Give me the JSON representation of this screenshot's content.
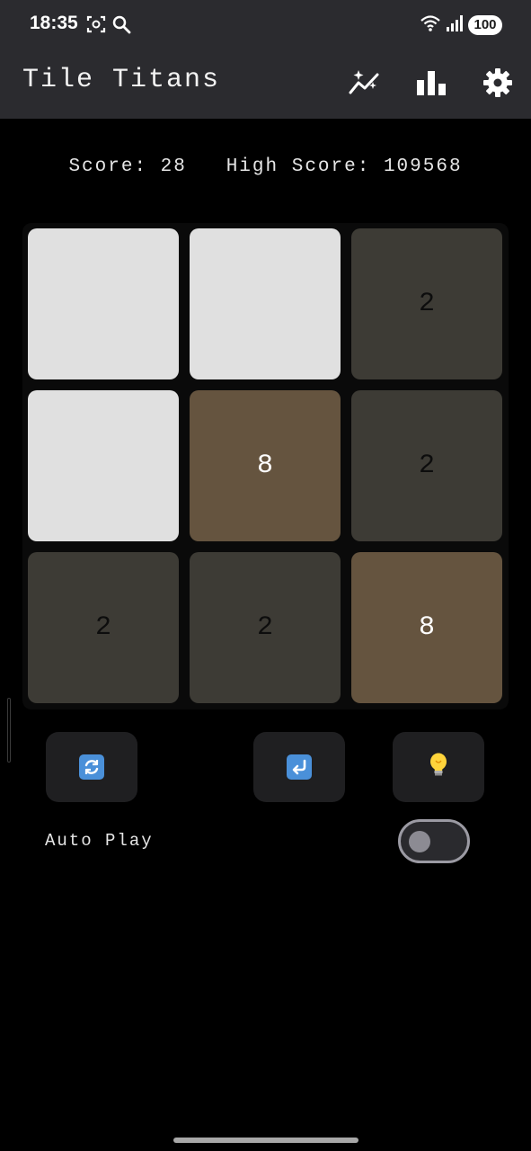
{
  "status_bar": {
    "time": "18:35",
    "battery": "100",
    "icons": [
      "screenshot-scan-icon",
      "search-icon",
      "wifi-icon",
      "signal-icon",
      "battery-icon"
    ]
  },
  "app_bar": {
    "title": "Tile Titans",
    "actions": [
      "magic-chart-icon",
      "bar-chart-icon",
      "gear-icon"
    ]
  },
  "scores": {
    "score_label": "Score:",
    "score_value": "28",
    "high_score_label": "High Score:",
    "high_score_value": "109568"
  },
  "board": {
    "size": 3,
    "tiles": [
      {
        "value": "",
        "color": "#e0e0e0",
        "text_color": "#111111"
      },
      {
        "value": "",
        "color": "#e0e0e0",
        "text_color": "#111111"
      },
      {
        "value": "2",
        "color": "#3d3b35",
        "text_color": "#0d0d0d"
      },
      {
        "value": "",
        "color": "#e0e0e0",
        "text_color": "#111111"
      },
      {
        "value": "8",
        "color": "#65543f",
        "text_color": "#ffffff"
      },
      {
        "value": "2",
        "color": "#3d3b35",
        "text_color": "#0d0d0d"
      },
      {
        "value": "2",
        "color": "#3d3b35",
        "text_color": "#0d0d0d"
      },
      {
        "value": "2",
        "color": "#3d3b35",
        "text_color": "#0d0d0d"
      },
      {
        "value": "8",
        "color": "#65543f",
        "text_color": "#ffffff"
      }
    ]
  },
  "controls": {
    "restart_icon": "restart-arrows-icon",
    "undo_icon": "undo-arrow-icon",
    "hint_icon": "lightbulb-icon"
  },
  "auto_play": {
    "label": "Auto Play",
    "enabled": false
  },
  "colors": {
    "bar_bg": "#2b2b2f",
    "page_bg": "#000000",
    "emoji_blue": "#4a90d9"
  }
}
